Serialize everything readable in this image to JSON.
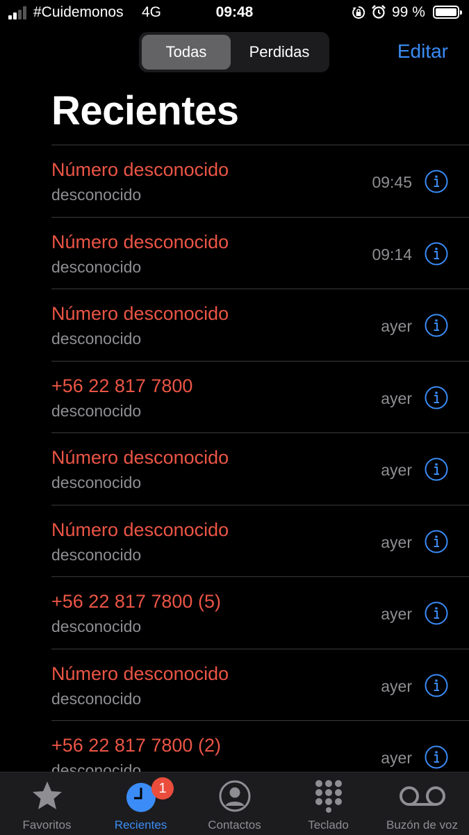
{
  "status_bar": {
    "carrier": "#Cuidemonos",
    "network": "4G",
    "time": "09:48",
    "battery_percent": "99 %",
    "icons": [
      "signal-icon",
      "orientation-lock-icon",
      "alarm-icon",
      "battery-icon"
    ]
  },
  "header": {
    "segments": [
      "Todas",
      "Perdidas"
    ],
    "selected_segment": "Todas",
    "edit_label": "Editar",
    "title": "Recientes"
  },
  "calls": [
    {
      "name": "Número desconocido",
      "type": "desconocido",
      "time": "09:45"
    },
    {
      "name": "Número desconocido",
      "type": "desconocido",
      "time": "09:14"
    },
    {
      "name": "Número desconocido",
      "type": "desconocido",
      "time": "ayer"
    },
    {
      "name": "+56 22 817 7800",
      "type": "desconocido",
      "time": "ayer"
    },
    {
      "name": "Número desconocido",
      "type": "desconocido",
      "time": "ayer"
    },
    {
      "name": "Número desconocido",
      "type": "desconocido",
      "time": "ayer"
    },
    {
      "name": "+56 22 817 7800 (5)",
      "type": "desconocido",
      "time": "ayer"
    },
    {
      "name": "Número desconocido",
      "type": "desconocido",
      "time": "ayer"
    },
    {
      "name": "+56 22 817 7800 (2)",
      "type": "desconocido",
      "time": "ayer"
    }
  ],
  "tab_bar": {
    "tabs": [
      {
        "label": "Favoritos",
        "icon": "star-icon"
      },
      {
        "label": "Recientes",
        "icon": "clock-icon"
      },
      {
        "label": "Contactos",
        "icon": "person-circle-icon"
      },
      {
        "label": "Teclado",
        "icon": "keypad-icon"
      },
      {
        "label": "Buzón de voz",
        "icon": "voicemail-icon"
      }
    ],
    "active_tab": "Recientes",
    "recientes_badge": "1"
  },
  "colors": {
    "missed_call": "#eb5545",
    "accent": "#3b8cf6",
    "secondary_text": "#8e8e93",
    "badge": "#eb4d3d"
  }
}
